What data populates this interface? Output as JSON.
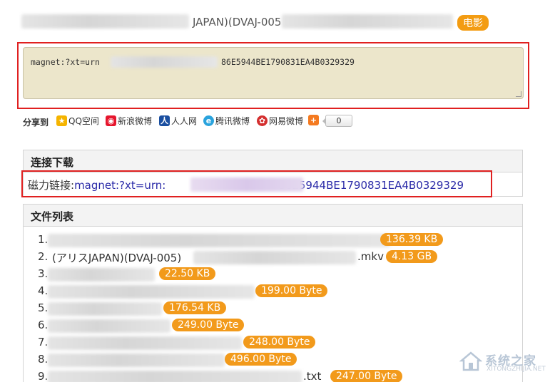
{
  "title": {
    "visible_text": "JAPAN)(DVAJ-005",
    "category_badge": "电影"
  },
  "magnet_box": {
    "prefix": "magnet:?xt=urn",
    "suffix": "86E5944BE1790831EA4B0329329"
  },
  "share": {
    "label": "分享到",
    "items": [
      {
        "icon": "qzone-icon",
        "label": "QQ空间",
        "color": "#f5b400"
      },
      {
        "icon": "weibo-icon",
        "label": "新浪微博",
        "color": "#e6162d"
      },
      {
        "icon": "renren-icon",
        "label": "人人网",
        "color": "#1a4fa0"
      },
      {
        "icon": "tencent-weibo-icon",
        "label": "腾讯微博",
        "color": "#2aa3dd"
      },
      {
        "icon": "netease-weibo-icon",
        "label": "网易微博",
        "color": "#d42f2f"
      },
      {
        "icon": "more-plus-icon",
        "label": "",
        "color": "#f47a20"
      }
    ],
    "count": "0"
  },
  "download": {
    "header": "连接下载",
    "label": "磁力链接:",
    "link_prefix": "magnet:?xt=urn:",
    "link_suffix": "86E5944BE1790831EA4B0329329"
  },
  "files": {
    "header": "文件列表",
    "items": [
      {
        "num": "1.",
        "name": "",
        "ext": "",
        "size": "136.39 KB"
      },
      {
        "num": "2.",
        "name": "(アリスJAPAN)(DVAJ-005)",
        "ext": ".mkv",
        "size": "4.13 GB"
      },
      {
        "num": "3.",
        "name": "",
        "ext": "",
        "size": "22.50 KB"
      },
      {
        "num": "4.",
        "name": "",
        "ext": "",
        "size": "199.00 Byte"
      },
      {
        "num": "5.",
        "name": "",
        "ext": "",
        "size": "176.54 KB"
      },
      {
        "num": "6.",
        "name": "",
        "ext": "",
        "size": "249.00 Byte"
      },
      {
        "num": "7.",
        "name": "",
        "ext": "",
        "size": "248.00 Byte"
      },
      {
        "num": "8.",
        "name": "",
        "ext": "",
        "size": "496.00 Byte"
      },
      {
        "num": "9.",
        "name": "",
        "ext": ".txt",
        "size": "247.00 Byte"
      }
    ]
  },
  "watermark": {
    "brand": "系统之家",
    "url": "XITONGZHIJIA.NET"
  },
  "colors": {
    "accent_orange": "#f29a1b",
    "highlight_red": "#e02020",
    "link_blue": "#2a2aa8",
    "textarea_bg": "#ece6cb"
  }
}
